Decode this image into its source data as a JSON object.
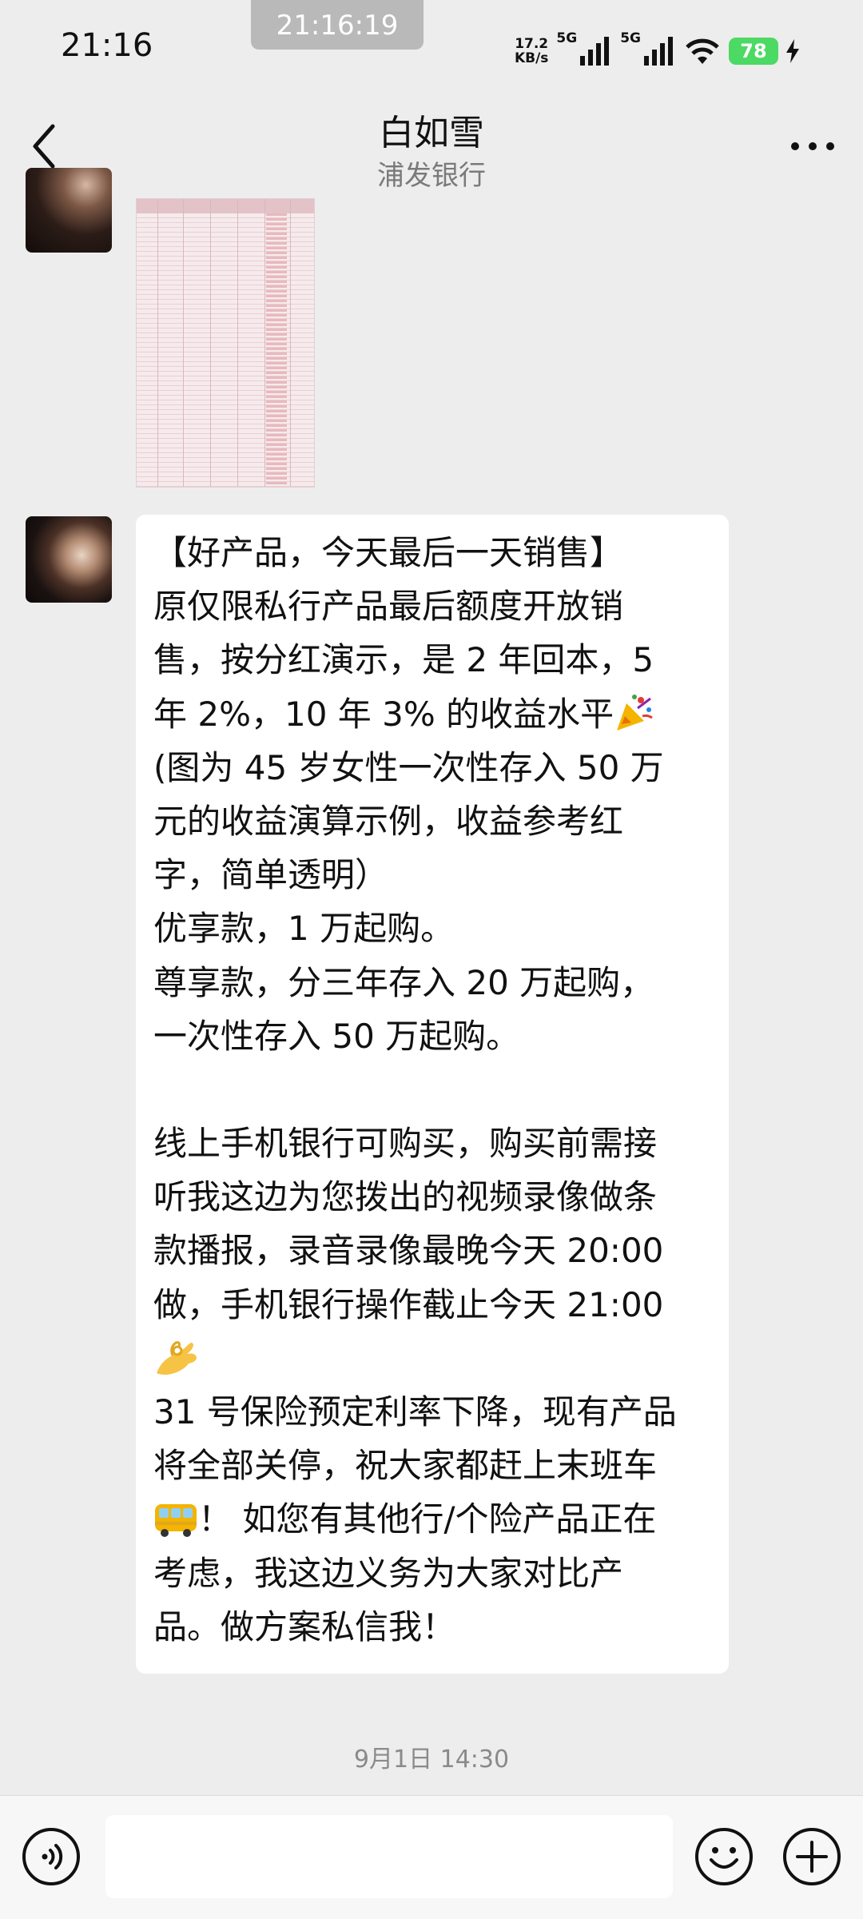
{
  "status_bar": {
    "time": "21:16",
    "clock_chip": "21:16:19",
    "net_speed_value": "17.2",
    "net_speed_unit": "KB/s",
    "signal_1_label": "5G",
    "signal_2_label": "5G",
    "battery": "78"
  },
  "header": {
    "title": "白如雪",
    "subtitle": "浦发银行",
    "back_icon": "chevron-left-icon",
    "more_icon": "more-horizontal-icon"
  },
  "messages": {
    "image_message": {
      "type": "image",
      "content": "table-screenshot"
    },
    "text_message": {
      "lines": [
        "【好产品，今天最后一天销售】",
        "原仅限私行产品最后额度开放销",
        "售，按分红演示，是 2 年回本，5",
        "年 2%，10 年 3% 的收益水平",
        "(图为 45 岁女性一次性存入 50 万",
        "元的收益演算示例，收益参考红",
        "字，简单透明）",
        "优享款，1 万起购。",
        "尊享款，分三年存入 20 万起购，",
        "一次性存入 50 万起购。",
        "",
        "线上手机银行可购买，购买前需接",
        "听我这边为您拨出的视频录像做条",
        "款播报，录音录像最晚今天 20:00",
        "做，手机银行操作截止今天 21:00",
        "",
        "31 号保险预定利率下降，现有产品",
        "将全部关停，祝大家都赶上末班车",
        "！ 如您有其他行/个险产品正在",
        "考虑，我这边义务为大家对比产",
        "品。做方案私信我！"
      ],
      "emojis": [
        "party-popper",
        "ok-hand",
        "bus"
      ]
    },
    "timestamp": "9月1日 14:30"
  },
  "input_bar": {
    "placeholder": "",
    "voice_icon": "voice-icon",
    "emoji_icon": "emoji-icon",
    "plus_icon": "plus-icon"
  }
}
